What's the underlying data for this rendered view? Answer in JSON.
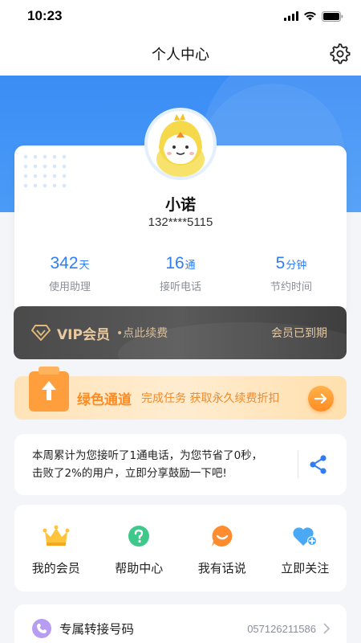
{
  "status_bar": {
    "time": "10:23"
  },
  "nav": {
    "title": "个人中心",
    "settings_icon": "gear-icon"
  },
  "profile": {
    "name": "小诺",
    "phone": "132****5115",
    "stats": [
      {
        "value": "342",
        "unit": "天",
        "label": "使用助理"
      },
      {
        "value": "16",
        "unit": "通",
        "label": "接听电话"
      },
      {
        "value": "5",
        "unit": "分钟",
        "label": "节约时间"
      }
    ]
  },
  "vip": {
    "title": "VIP会员",
    "subtitle": "•点此续费",
    "status": "会员已到期"
  },
  "green_channel": {
    "title": "绿色通道",
    "subtitle": "完成任务 获取永久续费折扣"
  },
  "summary": {
    "line1": "本周累计为您接听了1通电话，为您节省了0秒，",
    "line2": "击败了2%的用户，立即分享鼓励一下吧!"
  },
  "menu": [
    {
      "label": "我的会员",
      "icon": "crown-icon"
    },
    {
      "label": "帮助中心",
      "icon": "help-icon"
    },
    {
      "label": "我有话说",
      "icon": "smile-chat-icon"
    },
    {
      "label": "立即关注",
      "icon": "heart-plus-icon"
    }
  ],
  "transfer": {
    "label": "专属转接号码",
    "value": "057126211586"
  },
  "colors": {
    "primary": "#2f7df6",
    "vip_gold": "#e8c9a0",
    "orange": "#ff8a1f"
  }
}
